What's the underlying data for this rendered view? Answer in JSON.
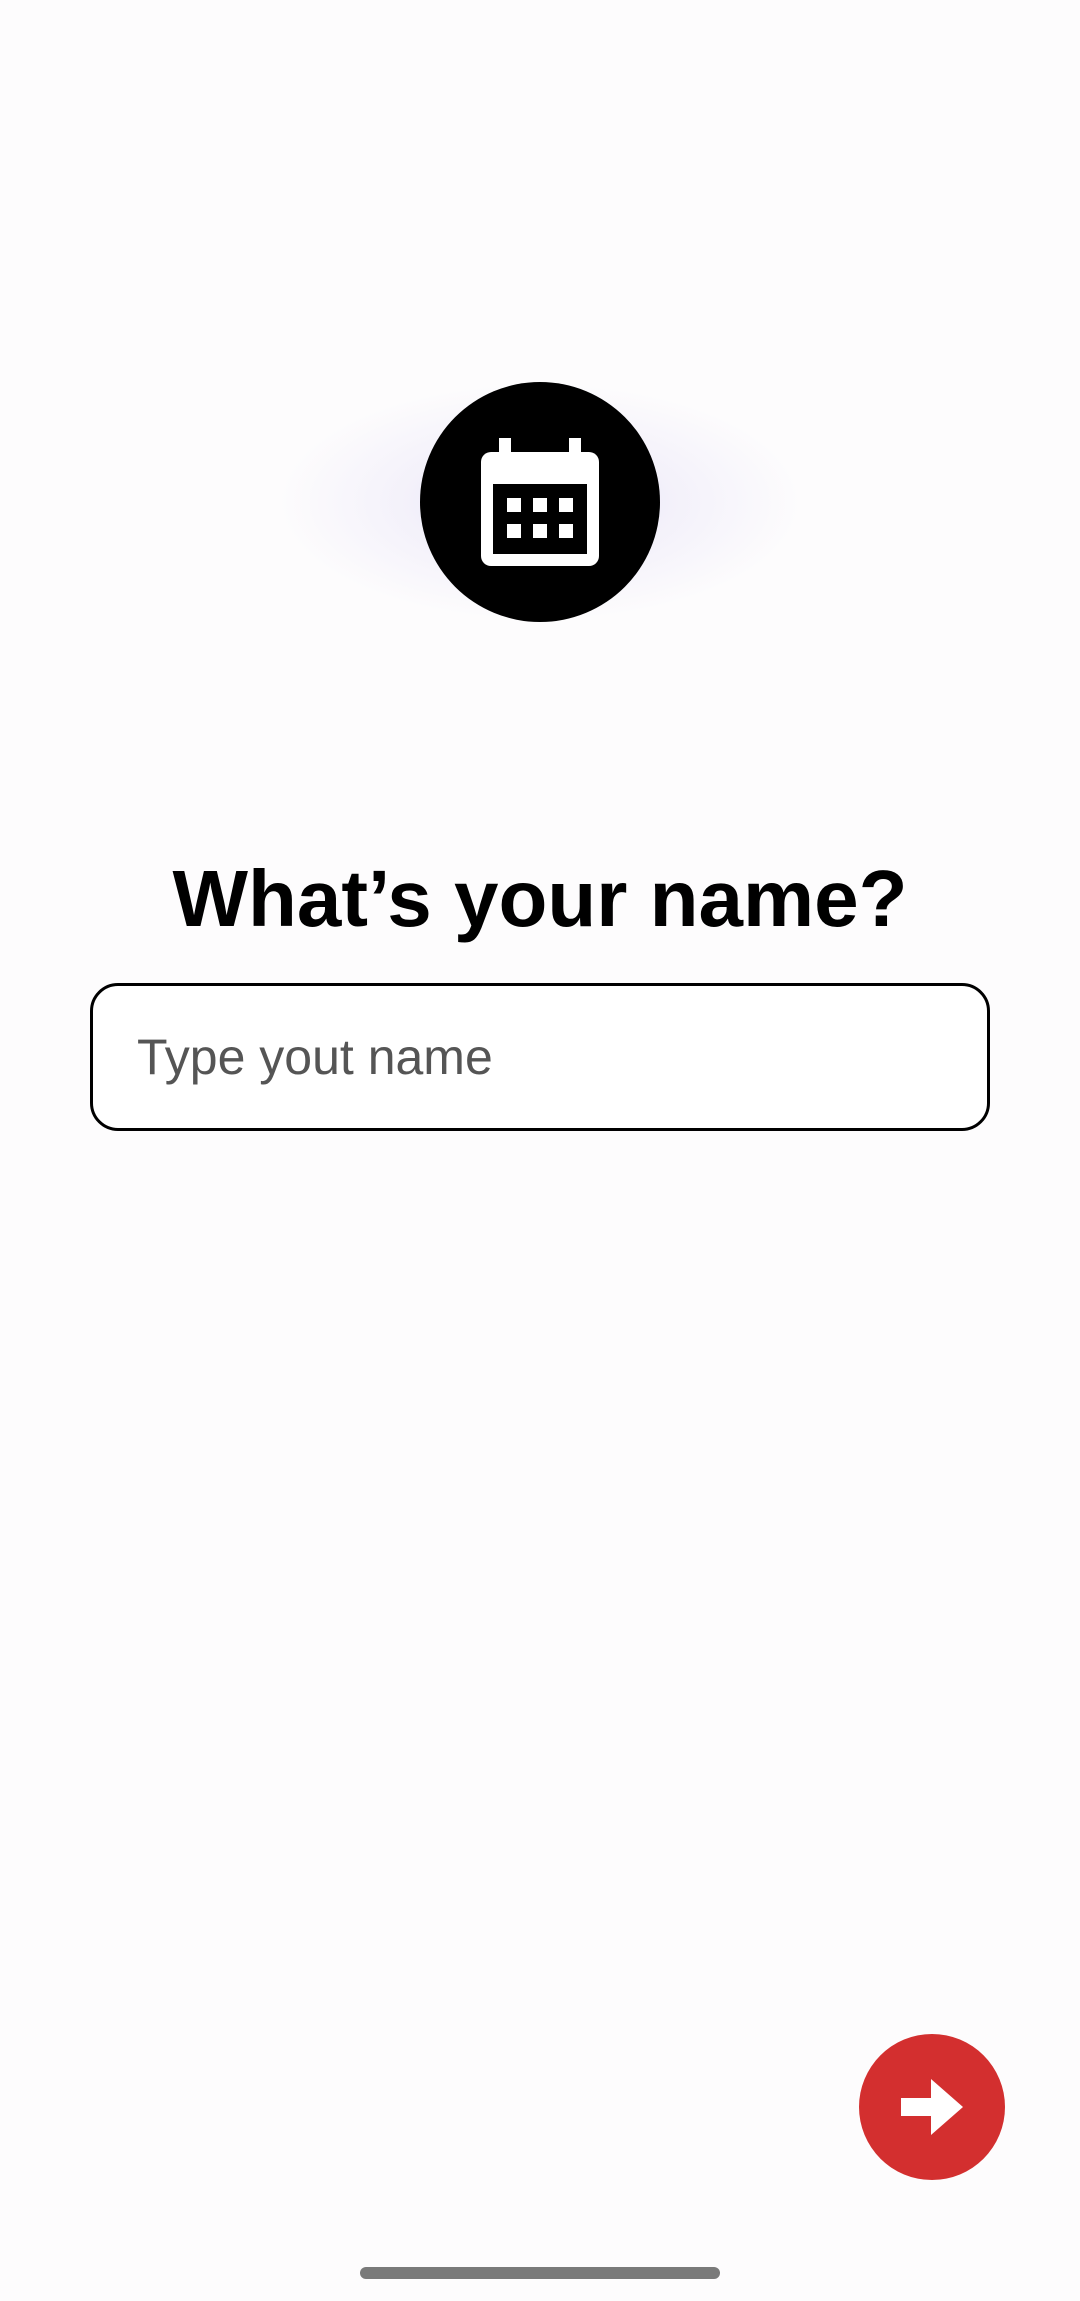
{
  "header": {
    "icon": "calendar-icon"
  },
  "main": {
    "title": "What’s your name?",
    "name_input": {
      "value": "",
      "placeholder": "Type yout name"
    }
  },
  "footer": {
    "next_icon": "arrow-right-icon"
  },
  "colors": {
    "background": "#fdfcfd",
    "icon_circle": "#000000",
    "accent": "#d32f2f",
    "home_indicator": "#7a7a7a"
  }
}
